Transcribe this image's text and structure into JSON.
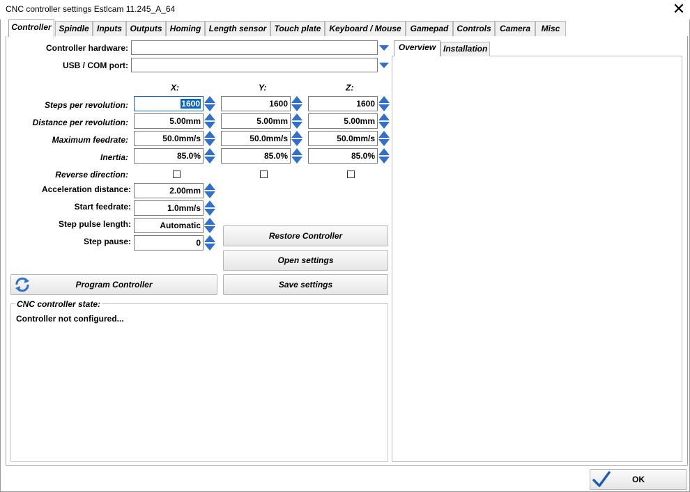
{
  "window": {
    "title": "CNC controller settings Estlcam 11.245_A_64",
    "close_symbol": "✕"
  },
  "tabs": [
    "Controller",
    "Spindle",
    "Inputs",
    "Outputs",
    "Homing",
    "Length sensor",
    "Touch plate",
    "Keyboard / Mouse",
    "Gamepad",
    "Controls",
    "Camera",
    "Misc"
  ],
  "active_tab": "Controller",
  "controller": {
    "hardware_label": "Controller hardware:",
    "hardware_value": "",
    "port_label": "USB / COM port:",
    "port_value": "",
    "axes": [
      "X:",
      "Y:",
      "Z:"
    ],
    "rows": [
      {
        "label": "Steps per revolution:",
        "values": [
          "1600",
          "1600",
          "1600"
        ]
      },
      {
        "label": "Distance per revolution:",
        "values": [
          "5.00mm",
          "5.00mm",
          "5.00mm"
        ]
      },
      {
        "label": "Maximum feedrate:",
        "values": [
          "50.0mm/s",
          "50.0mm/s",
          "50.0mm/s"
        ]
      },
      {
        "label": "Inertia:",
        "values": [
          "85.0%",
          "85.0%",
          "85.0%"
        ]
      }
    ],
    "reverse_label": "Reverse direction:",
    "reverse_checked": [
      false,
      false,
      false
    ],
    "single_rows": [
      {
        "label": "Acceleration distance:",
        "value": "2.00mm"
      },
      {
        "label": "Start feedrate:",
        "value": "1.0mm/s"
      },
      {
        "label": "Step pulse length:",
        "value": "Automatic"
      },
      {
        "label": "Step pause:",
        "value": "0"
      }
    ],
    "buttons": {
      "restore": "Restore Controller",
      "open": "Open settings",
      "save": "Save settings",
      "program": "Program Controller"
    },
    "state_title": "CNC controller  state:",
    "state_message": "Controller  not configured..."
  },
  "right_tabs": [
    "Overview",
    "Installation"
  ],
  "active_right_tab": "Overview",
  "ok_label": "OK",
  "colors": {
    "accent": "#2f6fce",
    "selection": "#0a64c8",
    "ok_check": "#1c5fb8"
  }
}
